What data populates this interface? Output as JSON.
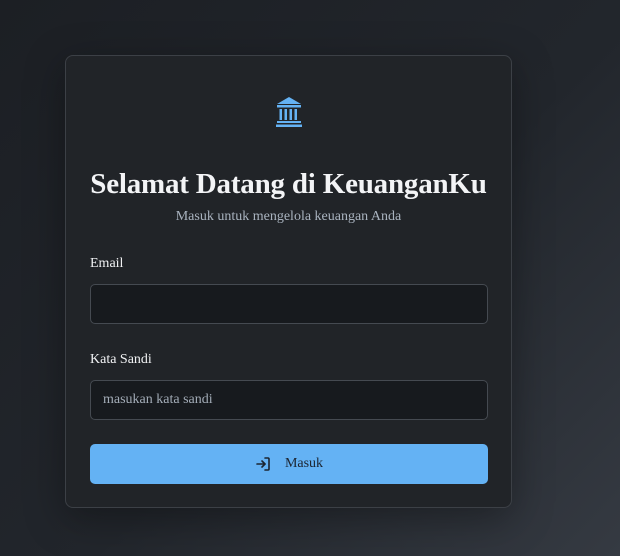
{
  "card": {
    "logo_icon": "bank-icon",
    "title": "Selamat Datang di KeuanganKu",
    "subtitle": "Masuk untuk mengelola keuangan Anda"
  },
  "form": {
    "email": {
      "label": "Email",
      "value": "",
      "placeholder": ""
    },
    "password": {
      "label": "Kata Sandi",
      "value": "",
      "placeholder": "masukan kata sandi"
    },
    "submit": {
      "label": "Masuk",
      "icon": "sign-in-icon"
    }
  },
  "colors": {
    "accent": "#64b2f4",
    "card_bg": "#212428",
    "input_bg": "#171a1e"
  }
}
